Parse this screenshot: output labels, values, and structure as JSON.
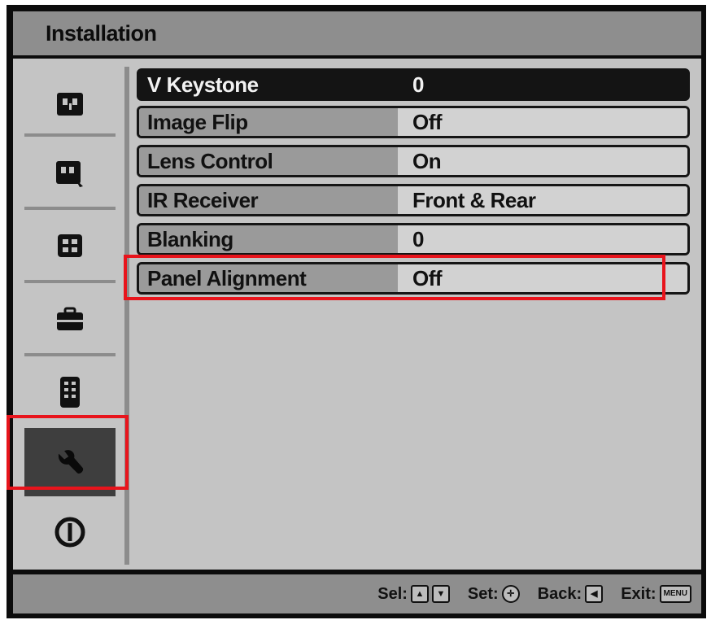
{
  "title": "Installation",
  "sidebar": {
    "items": [
      {
        "icon": "picture-icon"
      },
      {
        "icon": "picture-adjust-icon"
      },
      {
        "icon": "grid-icon"
      },
      {
        "icon": "briefcase-icon"
      },
      {
        "icon": "remote-icon"
      },
      {
        "icon": "wrench-icon",
        "selected": true
      },
      {
        "icon": "info-icon"
      }
    ]
  },
  "menu": {
    "rows": [
      {
        "label": "V Keystone",
        "value": "0",
        "selected": true
      },
      {
        "label": "Image Flip",
        "value": "Off"
      },
      {
        "label": "Lens Control",
        "value": "On"
      },
      {
        "label": "IR Receiver",
        "value": "Front & Rear"
      },
      {
        "label": "Blanking",
        "value": "0"
      },
      {
        "label": "Panel Alignment",
        "value": "Off"
      }
    ]
  },
  "footer": {
    "sel_label": "Sel:",
    "set_label": "Set:",
    "back_label": "Back:",
    "exit_label": "Exit:",
    "menu_key": "MENU"
  },
  "colors": {
    "highlight": "#e8141c",
    "selected_bg": "#141414",
    "panel_bg": "#c4c4c4"
  }
}
